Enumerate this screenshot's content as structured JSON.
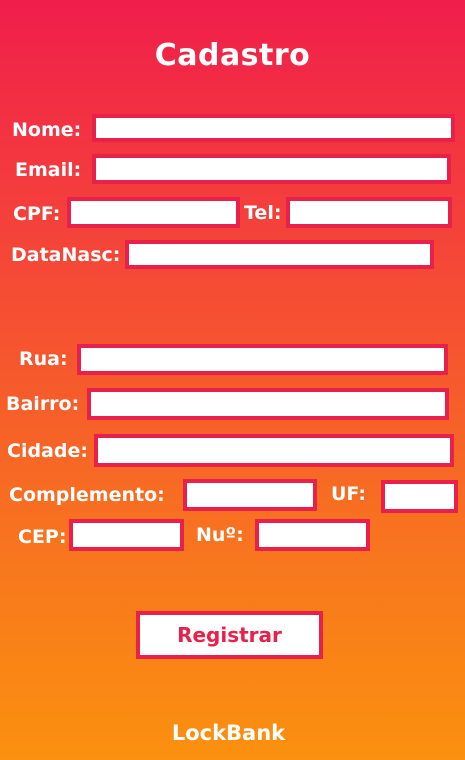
{
  "header": {
    "title": "Cadastro"
  },
  "personal": {
    "name_label": "Nome:",
    "name_value": "",
    "email_label": "Email:",
    "email_value": "",
    "cpf_label": "CPF:",
    "cpf_value": "",
    "tel_label": "Tel:",
    "tel_value": "",
    "birth_label": "DataNasc:",
    "birth_value": ""
  },
  "address": {
    "street_label": "Rua:",
    "street_value": "",
    "district_label": "Bairro:",
    "district_value": "",
    "city_label": "Cidade:",
    "city_value": "",
    "complement_label": "Complemento:",
    "complement_value": "",
    "uf_label": "UF:",
    "uf_value": "",
    "cep_label": "CEP:",
    "cep_value": "",
    "number_label": "Nuº:",
    "number_value": ""
  },
  "actions": {
    "register_label": "Registrar"
  },
  "footer": {
    "brand": "LockBank"
  },
  "colors": {
    "gradient_top": "#f01e4b",
    "gradient_bottom": "#fb910f",
    "field_border": "#e8214a",
    "button_text": "#e8214a"
  }
}
